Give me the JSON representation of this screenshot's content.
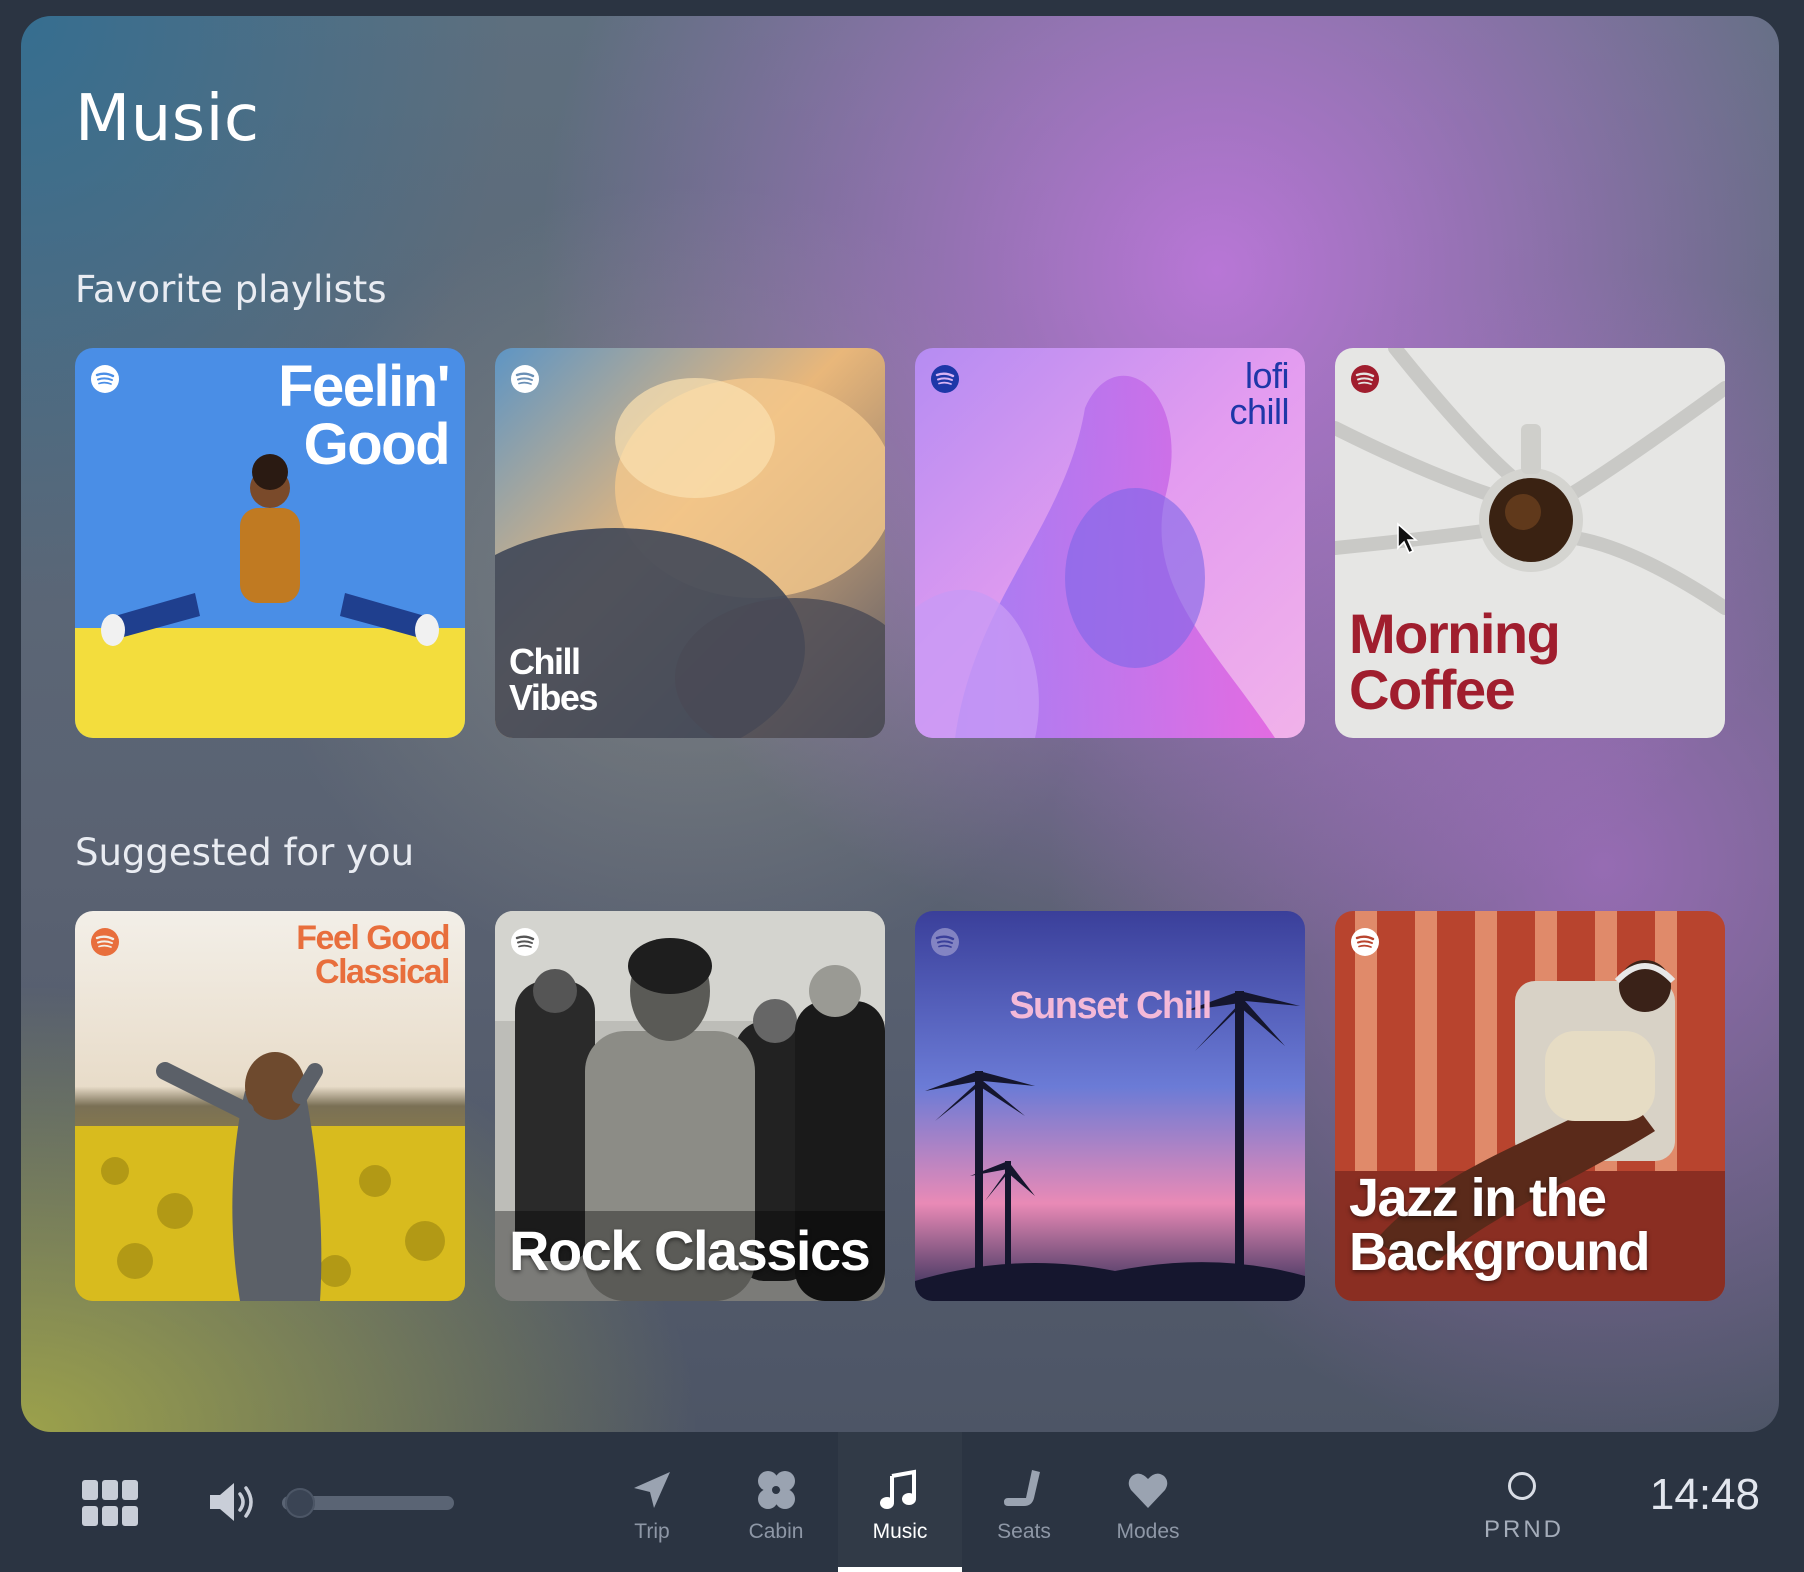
{
  "page": {
    "title": "Music"
  },
  "sections": {
    "favorites": {
      "title": "Favorite playlists",
      "playlists": [
        {
          "title": "Feelin'\nGood",
          "accent": "#ffffff"
        },
        {
          "title": "Chill\nVibes",
          "accent": "#ffffff"
        },
        {
          "title": "lofi\nchill",
          "accent": "#1e37a8"
        },
        {
          "title": "Morning\nCoffee",
          "accent": "#a01e2e"
        }
      ]
    },
    "suggested": {
      "title": "Suggested for you",
      "playlists": [
        {
          "title": "Feel Good\nClassical",
          "accent": "#e86e3c"
        },
        {
          "title": "Rock Classics",
          "accent": "#ffffff"
        },
        {
          "title": "Sunset Chill",
          "accent": "#f4b9d8"
        },
        {
          "title": "Jazz in the\nBackground",
          "accent": "#ffffff"
        }
      ]
    }
  },
  "bottom_bar": {
    "apps_icon": "grid-icon",
    "volume_icon": "speaker-icon",
    "volume_level": 0.05,
    "nav": [
      {
        "label": "Trip",
        "icon": "navigation-arrow-icon"
      },
      {
        "label": "Cabin",
        "icon": "fan-icon"
      },
      {
        "label": "Music",
        "icon": "music-note-icon",
        "active": true
      },
      {
        "label": "Seats",
        "icon": "seat-icon"
      },
      {
        "label": "Modes",
        "icon": "heart-icon"
      }
    ],
    "gear": {
      "indicator": "O",
      "label": "PRND"
    },
    "clock": "14:48"
  },
  "colors": {
    "background": "#2b3442",
    "nav_inactive": "#8e97a6",
    "nav_active": "#ffffff",
    "spotify_white": "#ffffff",
    "spotify_blue": "#1e37a8",
    "spotify_red": "#a01e2e",
    "spotify_orange": "#e86e3c"
  }
}
